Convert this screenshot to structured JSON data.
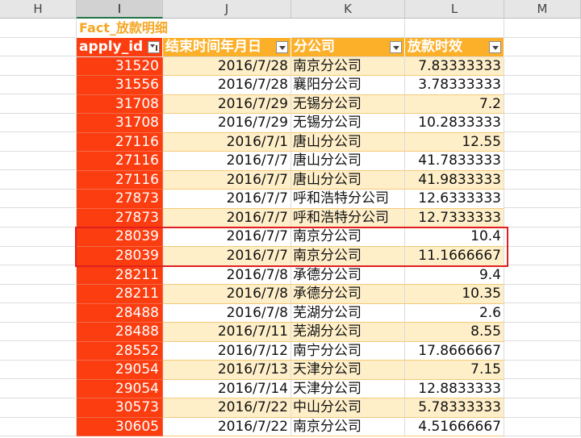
{
  "columns": [
    "H",
    "I",
    "J",
    "K",
    "L",
    "M"
  ],
  "selected_column": "I",
  "table": {
    "title": "Fact_放款明细",
    "headers": [
      "apply_id",
      "结束时间年月日",
      "分公司",
      "放款时效"
    ],
    "rows": [
      [
        "31520",
        "2016/7/28",
        "南京分公司",
        "7.83333333"
      ],
      [
        "31556",
        "2016/7/28",
        "襄阳分公司",
        "3.78333333"
      ],
      [
        "31708",
        "2016/7/29",
        "无锡分公司",
        "7.2"
      ],
      [
        "31708",
        "2016/7/29",
        "无锡分公司",
        "10.2833333"
      ],
      [
        "27116",
        "2016/7/1",
        "唐山分公司",
        "12.55"
      ],
      [
        "27116",
        "2016/7/7",
        "唐山分公司",
        "41.7833333"
      ],
      [
        "27116",
        "2016/7/7",
        "唐山分公司",
        "41.9833333"
      ],
      [
        "27873",
        "2016/7/7",
        "呼和浩特分公司",
        "12.6333333"
      ],
      [
        "27873",
        "2016/7/7",
        "呼和浩特分公司",
        "12.7333333"
      ],
      [
        "28039",
        "2016/7/7",
        "南京分公司",
        "10.4"
      ],
      [
        "28039",
        "2016/7/7",
        "南京分公司",
        "11.1666667"
      ],
      [
        "28211",
        "2016/7/8",
        "承德分公司",
        "9.4"
      ],
      [
        "28211",
        "2016/7/8",
        "承德分公司",
        "10.35"
      ],
      [
        "28488",
        "2016/7/8",
        "芜湖分公司",
        "2.6"
      ],
      [
        "28488",
        "2016/7/11",
        "芜湖分公司",
        "8.55"
      ],
      [
        "28552",
        "2016/7/12",
        "南宁分公司",
        "17.8666667"
      ],
      [
        "29054",
        "2016/7/13",
        "天津分公司",
        "7.15"
      ],
      [
        "29054",
        "2016/7/14",
        "天津分公司",
        "12.8833333"
      ],
      [
        "30573",
        "2016/7/22",
        "中山分公司",
        "5.78333333"
      ],
      [
        "30605",
        "2016/7/22",
        "南京分公司",
        "4.51666667"
      ]
    ],
    "highlight_rows": [
      9,
      10
    ]
  },
  "colors": {
    "id_fill": "#fc3d10",
    "header_fill": "#fcb02a",
    "band_fill": "#ffefc9",
    "title_text": "#f5a623",
    "highlight_border": "#e02020"
  }
}
